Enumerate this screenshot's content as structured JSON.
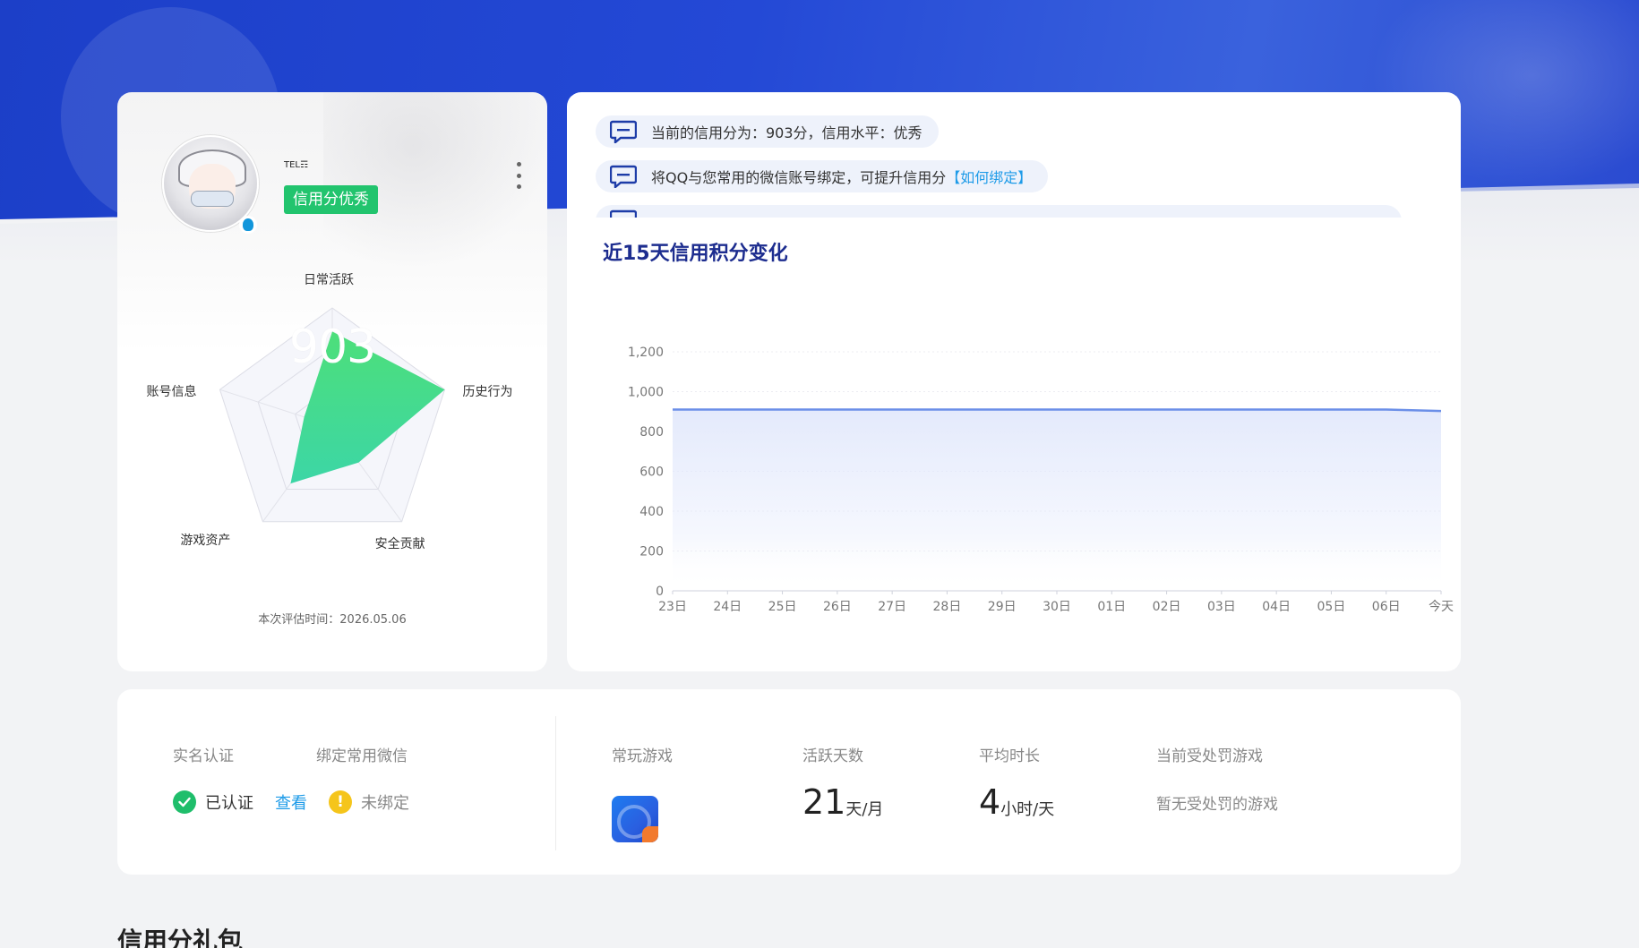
{
  "profile": {
    "nickname": "TEL☶",
    "level_badge": "信用分优秀",
    "score": "903",
    "radar_labels": [
      "日常活跃",
      "历史行为",
      "安全贡献",
      "游戏资产",
      "账号信息"
    ],
    "radar_values": [
      0.8,
      1.0,
      0.38,
      0.6,
      0.25
    ],
    "eval_time": "本次评估时间：2026.05.06",
    "colors": {
      "badge": "#22c46e",
      "radar_fill_start": "#4ddf7a",
      "radar_fill_end": "#3cd6a6"
    }
  },
  "notices": [
    {
      "text": "当前的信用分为：903分，信用水平：优秀",
      "link": ""
    },
    {
      "text": "将QQ与您常用的微信账号绑定，可提升信用分",
      "link": "【如何绑定】"
    }
  ],
  "chart_data": {
    "type": "area",
    "title": "近15天信用积分变化",
    "categories": [
      "23日",
      "24日",
      "25日",
      "26日",
      "27日",
      "28日",
      "29日",
      "30日",
      "01日",
      "02日",
      "03日",
      "04日",
      "05日",
      "06日",
      "今天"
    ],
    "values": [
      910,
      910,
      910,
      910,
      910,
      910,
      910,
      910,
      910,
      910,
      910,
      910,
      910,
      910,
      903
    ],
    "y_ticks": [
      "0",
      "200",
      "400",
      "600",
      "800",
      "1,000",
      "1,200"
    ],
    "ylim": [
      0,
      1200
    ],
    "grid": true,
    "colors": {
      "line": "#6b8fe8",
      "fill": "#e4eafc"
    }
  },
  "stats": {
    "realname_label": "实名认证",
    "realname_value": "已认证",
    "realname_link": "查看",
    "wechat_label": "绑定常用微信",
    "wechat_value": "未绑定",
    "game_label": "常玩游戏",
    "active_label": "活跃天数",
    "active_value": "21",
    "active_unit": "天/月",
    "duration_label": "平均时长",
    "duration_value": "4",
    "duration_unit": "小时/天",
    "penalty_label": "当前受处罚游戏",
    "penalty_value": "暂无受处罚的游戏"
  },
  "gift_title": "信用分礼包"
}
